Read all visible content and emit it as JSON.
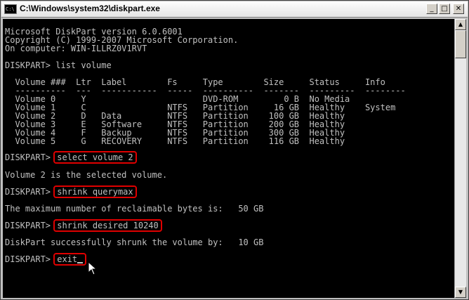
{
  "window": {
    "title": "C:\\Windows\\system32\\diskpart.exe",
    "icon": "console-icon"
  },
  "controls": {
    "minimize": "_",
    "maximize": "□",
    "close": "✕"
  },
  "console": {
    "header": [
      "Microsoft DiskPart version 6.0.6001",
      "Copyright (C) 1999-2007 Microsoft Corporation.",
      "On computer: WIN-ILLRZ0V1RVT"
    ],
    "list_cmd": "DISKPART> list volume",
    "table_header": "  Volume ###  Ltr  Label        Fs     Type        Size     Status     Info",
    "table_separator": "  ----------  ---  -----------  -----  ----------  -------  ---------  --------",
    "volumes": [
      "  Volume 0     Y                       DVD-ROM         0 B  No Media",
      "  Volume 1     C                NTFS   Partition     16 GB  Healthy    System",
      "  Volume 2     D   Data         NTFS   Partition    100 GB  Healthy",
      "  Volume 3     E   Software     NTFS   Partition    200 GB  Healthy",
      "  Volume 4     F   Backup       NTFS   Partition    300 GB  Healthy",
      "  Volume 5     G   RECOVERY     NTFS   Partition    116 GB  Healthy"
    ],
    "prompt": "DISKPART> ",
    "commands": [
      {
        "cmd": "select volume 2",
        "output": "Volume 2 is the selected volume."
      },
      {
        "cmd": "shrink querymax",
        "output": "The maximum number of reclaimable bytes is:   50 GB"
      },
      {
        "cmd": "shrink desired 10240",
        "output": "DiskPart successfully shrunk the volume by:   10 GB"
      },
      {
        "cmd": "exit",
        "output": ""
      }
    ]
  },
  "colors": {
    "console_bg": "#000000",
    "console_fg": "#c0c0c0",
    "highlight": "#e00000"
  }
}
